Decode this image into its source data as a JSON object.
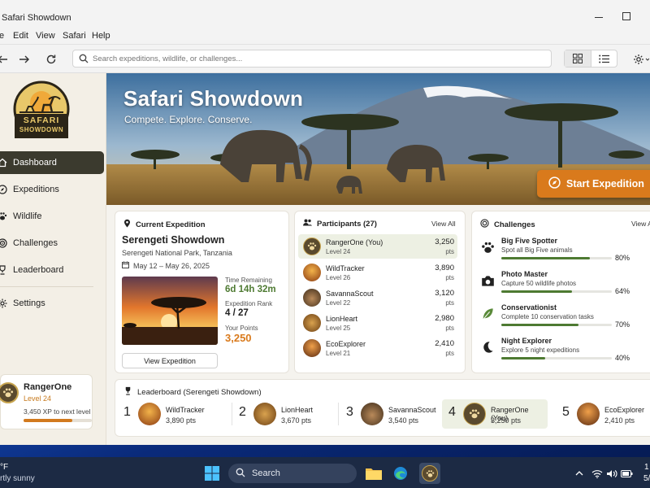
{
  "window": {
    "title": "Safari Showdown"
  },
  "menu": [
    "e",
    "Edit",
    "View",
    "Safari",
    "Help"
  ],
  "search": {
    "placeholder": "Search expeditions, wildlife, or challenges..."
  },
  "sidebar": {
    "logo_line1": "SAFARI",
    "logo_line2": "SHOWDOWN",
    "items": [
      {
        "label": "Dashboard",
        "icon": "home-icon"
      },
      {
        "label": "Expeditions",
        "icon": "compass-icon"
      },
      {
        "label": "Wildlife",
        "icon": "paw-icon"
      },
      {
        "label": "Challenges",
        "icon": "target-icon"
      },
      {
        "label": "Leaderboard",
        "icon": "trophy-icon"
      },
      {
        "label": "Settings",
        "icon": "gear-icon"
      }
    ],
    "user": {
      "name": "RangerOne",
      "level": "Level 24",
      "xp": "3,450 XP to next level",
      "xp_progress": 0.72
    }
  },
  "hero": {
    "title": "Safari Showdown",
    "subtitle": "Compete. Explore. Conserve.",
    "cta": "Start Expedition"
  },
  "current_expedition": {
    "header": "Current Expedition",
    "name": "Serengeti Showdown",
    "location": "Serengeti National Park, Tanzania",
    "dates": "May 12 – May 26, 2025",
    "time_label": "Time Remaining",
    "time_value": "6d 14h 32m",
    "rank_label": "Expedition Rank",
    "rank_value": "4 / 27",
    "points_label": "Your Points",
    "points_value": "3,250",
    "button": "View Expedition"
  },
  "participants": {
    "header": "Participants (27)",
    "view_all": "View All",
    "unit": "pts",
    "rows": [
      {
        "name": "RangerOne (You)",
        "level": "Level 24",
        "points": "3,250"
      },
      {
        "name": "WildTracker",
        "level": "Level 26",
        "points": "3,890"
      },
      {
        "name": "SavannaScout",
        "level": "Level 22",
        "points": "3,120"
      },
      {
        "name": "LionHeart",
        "level": "Level 25",
        "points": "2,980"
      },
      {
        "name": "EcoExplorer",
        "level": "Level 21",
        "points": "2,410"
      }
    ]
  },
  "challenges": {
    "header": "Challenges",
    "view_all": "View A",
    "items": [
      {
        "name": "Big Five Spotter",
        "desc": "Spot all Big Five animals",
        "progress": 80,
        "label": "80%",
        "icon": "paw-icon"
      },
      {
        "name": "Photo Master",
        "desc": "Capture 50 wildlife photos",
        "progress": 64,
        "label": "64%",
        "icon": "camera-icon"
      },
      {
        "name": "Conservationist",
        "desc": "Complete 10 conservation tasks",
        "progress": 70,
        "label": "70%",
        "icon": "leaf-icon"
      },
      {
        "name": "Night Explorer",
        "desc": "Explore 5 night expeditions",
        "progress": 40,
        "label": "40%",
        "icon": "moon-icon"
      }
    ]
  },
  "leaderboard": {
    "header": "Leaderboard (Serengeti Showdown)",
    "entries": [
      {
        "rank": "1",
        "name": "WildTracker",
        "points": "3,890 pts"
      },
      {
        "rank": "2",
        "name": "LionHeart",
        "points": "3,670 pts"
      },
      {
        "rank": "3",
        "name": "SavannaScout",
        "points": "3,540 pts"
      },
      {
        "rank": "4",
        "name": "RangerOne (You)",
        "points": "3,250 pts"
      },
      {
        "rank": "5",
        "name": "EcoExplorer",
        "points": "2,410 pts"
      }
    ]
  },
  "taskbar": {
    "weather_temp": "°F",
    "weather_desc": "rtly sunny",
    "search": "Search",
    "clock_time": "1",
    "clock_date": "5/"
  },
  "colors": {
    "accent": "#d97a1c",
    "nav_active": "#3b3a2e",
    "progress": "#4e7a32",
    "highlight": "#edf0e3"
  }
}
